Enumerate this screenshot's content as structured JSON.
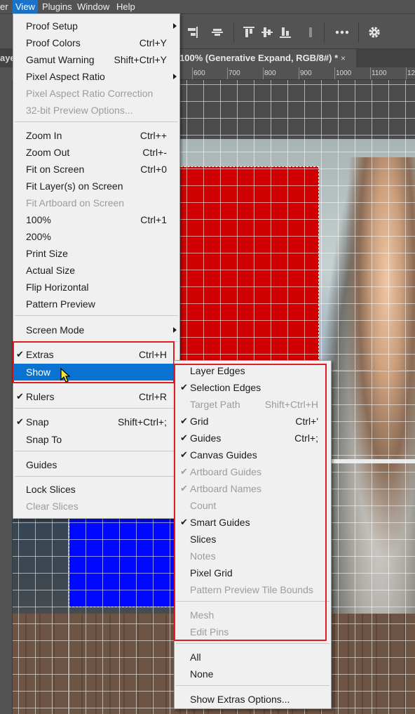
{
  "menubar": {
    "items": [
      {
        "label": "er"
      },
      {
        "label": "View",
        "active": true
      },
      {
        "label": "Plugins"
      },
      {
        "label": "Window"
      },
      {
        "label": "Help"
      }
    ]
  },
  "document_tab": {
    "left_partial": "aye",
    "title": "100% (Generative Expand, RGB/8#) *",
    "close": "×"
  },
  "ruler": {
    "labels": [
      "600",
      "700",
      "800",
      "900",
      "1000",
      "1100",
      "12"
    ]
  },
  "view_menu": {
    "items": [
      {
        "label": "Proof Setup",
        "submenu": true
      },
      {
        "label": "Proof Colors",
        "shortcut": "Ctrl+Y"
      },
      {
        "label": "Gamut Warning",
        "shortcut": "Shift+Ctrl+Y"
      },
      {
        "label": "Pixel Aspect Ratio",
        "submenu": true
      },
      {
        "label": "Pixel Aspect Ratio Correction",
        "disabled": true
      },
      {
        "label": "32-bit Preview Options...",
        "disabled": true
      },
      {
        "label": "Zoom In",
        "shortcut": "Ctrl++"
      },
      {
        "label": "Zoom Out",
        "shortcut": "Ctrl+-"
      },
      {
        "label": "Fit on Screen",
        "shortcut": "Ctrl+0"
      },
      {
        "label": "Fit Layer(s) on Screen"
      },
      {
        "label": "Fit Artboard on Screen",
        "disabled": true
      },
      {
        "label": "100%",
        "shortcut": "Ctrl+1"
      },
      {
        "label": "200%"
      },
      {
        "label": "Print Size"
      },
      {
        "label": "Actual Size"
      },
      {
        "label": "Flip Horizontal"
      },
      {
        "label": "Pattern Preview"
      },
      {
        "label": "Screen Mode",
        "submenu": true
      },
      {
        "label": "Extras",
        "shortcut": "Ctrl+H",
        "checked": true
      },
      {
        "label": "Show",
        "submenu": true,
        "highlighted": true
      },
      {
        "label": "Rulers",
        "shortcut": "Ctrl+R",
        "checked": true
      },
      {
        "label": "Snap",
        "shortcut": "Shift+Ctrl+;",
        "checked": true
      },
      {
        "label": "Snap To",
        "submenu": true
      },
      {
        "label": "Guides",
        "submenu": true
      },
      {
        "label": "Lock Slices"
      },
      {
        "label": "Clear Slices",
        "disabled": true
      }
    ]
  },
  "show_menu": {
    "items": [
      {
        "label": "Layer Edges"
      },
      {
        "label": "Selection Edges",
        "checked": true
      },
      {
        "label": "Target Path",
        "shortcut": "Shift+Ctrl+H",
        "disabled": true
      },
      {
        "label": "Grid",
        "shortcut": "Ctrl+'",
        "checked": true
      },
      {
        "label": "Guides",
        "shortcut": "Ctrl+;",
        "checked": true
      },
      {
        "label": "Canvas Guides",
        "checked": true
      },
      {
        "label": "Artboard Guides",
        "checked": true,
        "disabled": true
      },
      {
        "label": "Artboard Names",
        "checked": true,
        "disabled": true
      },
      {
        "label": "Count",
        "disabled": true
      },
      {
        "label": "Smart Guides",
        "checked": true
      },
      {
        "label": "Slices"
      },
      {
        "label": "Notes",
        "disabled": true
      },
      {
        "label": "Pixel Grid"
      },
      {
        "label": "Pattern Preview Tile Bounds",
        "disabled": true
      },
      {
        "label": "Mesh",
        "disabled": true
      },
      {
        "label": "Edit Pins",
        "disabled": true
      },
      {
        "label": "All"
      },
      {
        "label": "None"
      },
      {
        "label": "Show Extras Options..."
      }
    ]
  },
  "colors": {
    "menu_bg": "#f0f0f0",
    "highlight": "#0a73d1",
    "annotation_red": "#e01c24",
    "guide_cyan": "#27d7e0",
    "red_layer": "#d10000",
    "blue_layer": "#0008ff"
  },
  "icons": {
    "check": "✔",
    "toolbar": [
      "align-right-icon",
      "align-center-h-icon",
      "align-top-icon",
      "align-middle-v-icon",
      "align-bottom-icon",
      "distribute-icon",
      "more-icon",
      "gear-icon"
    ]
  }
}
